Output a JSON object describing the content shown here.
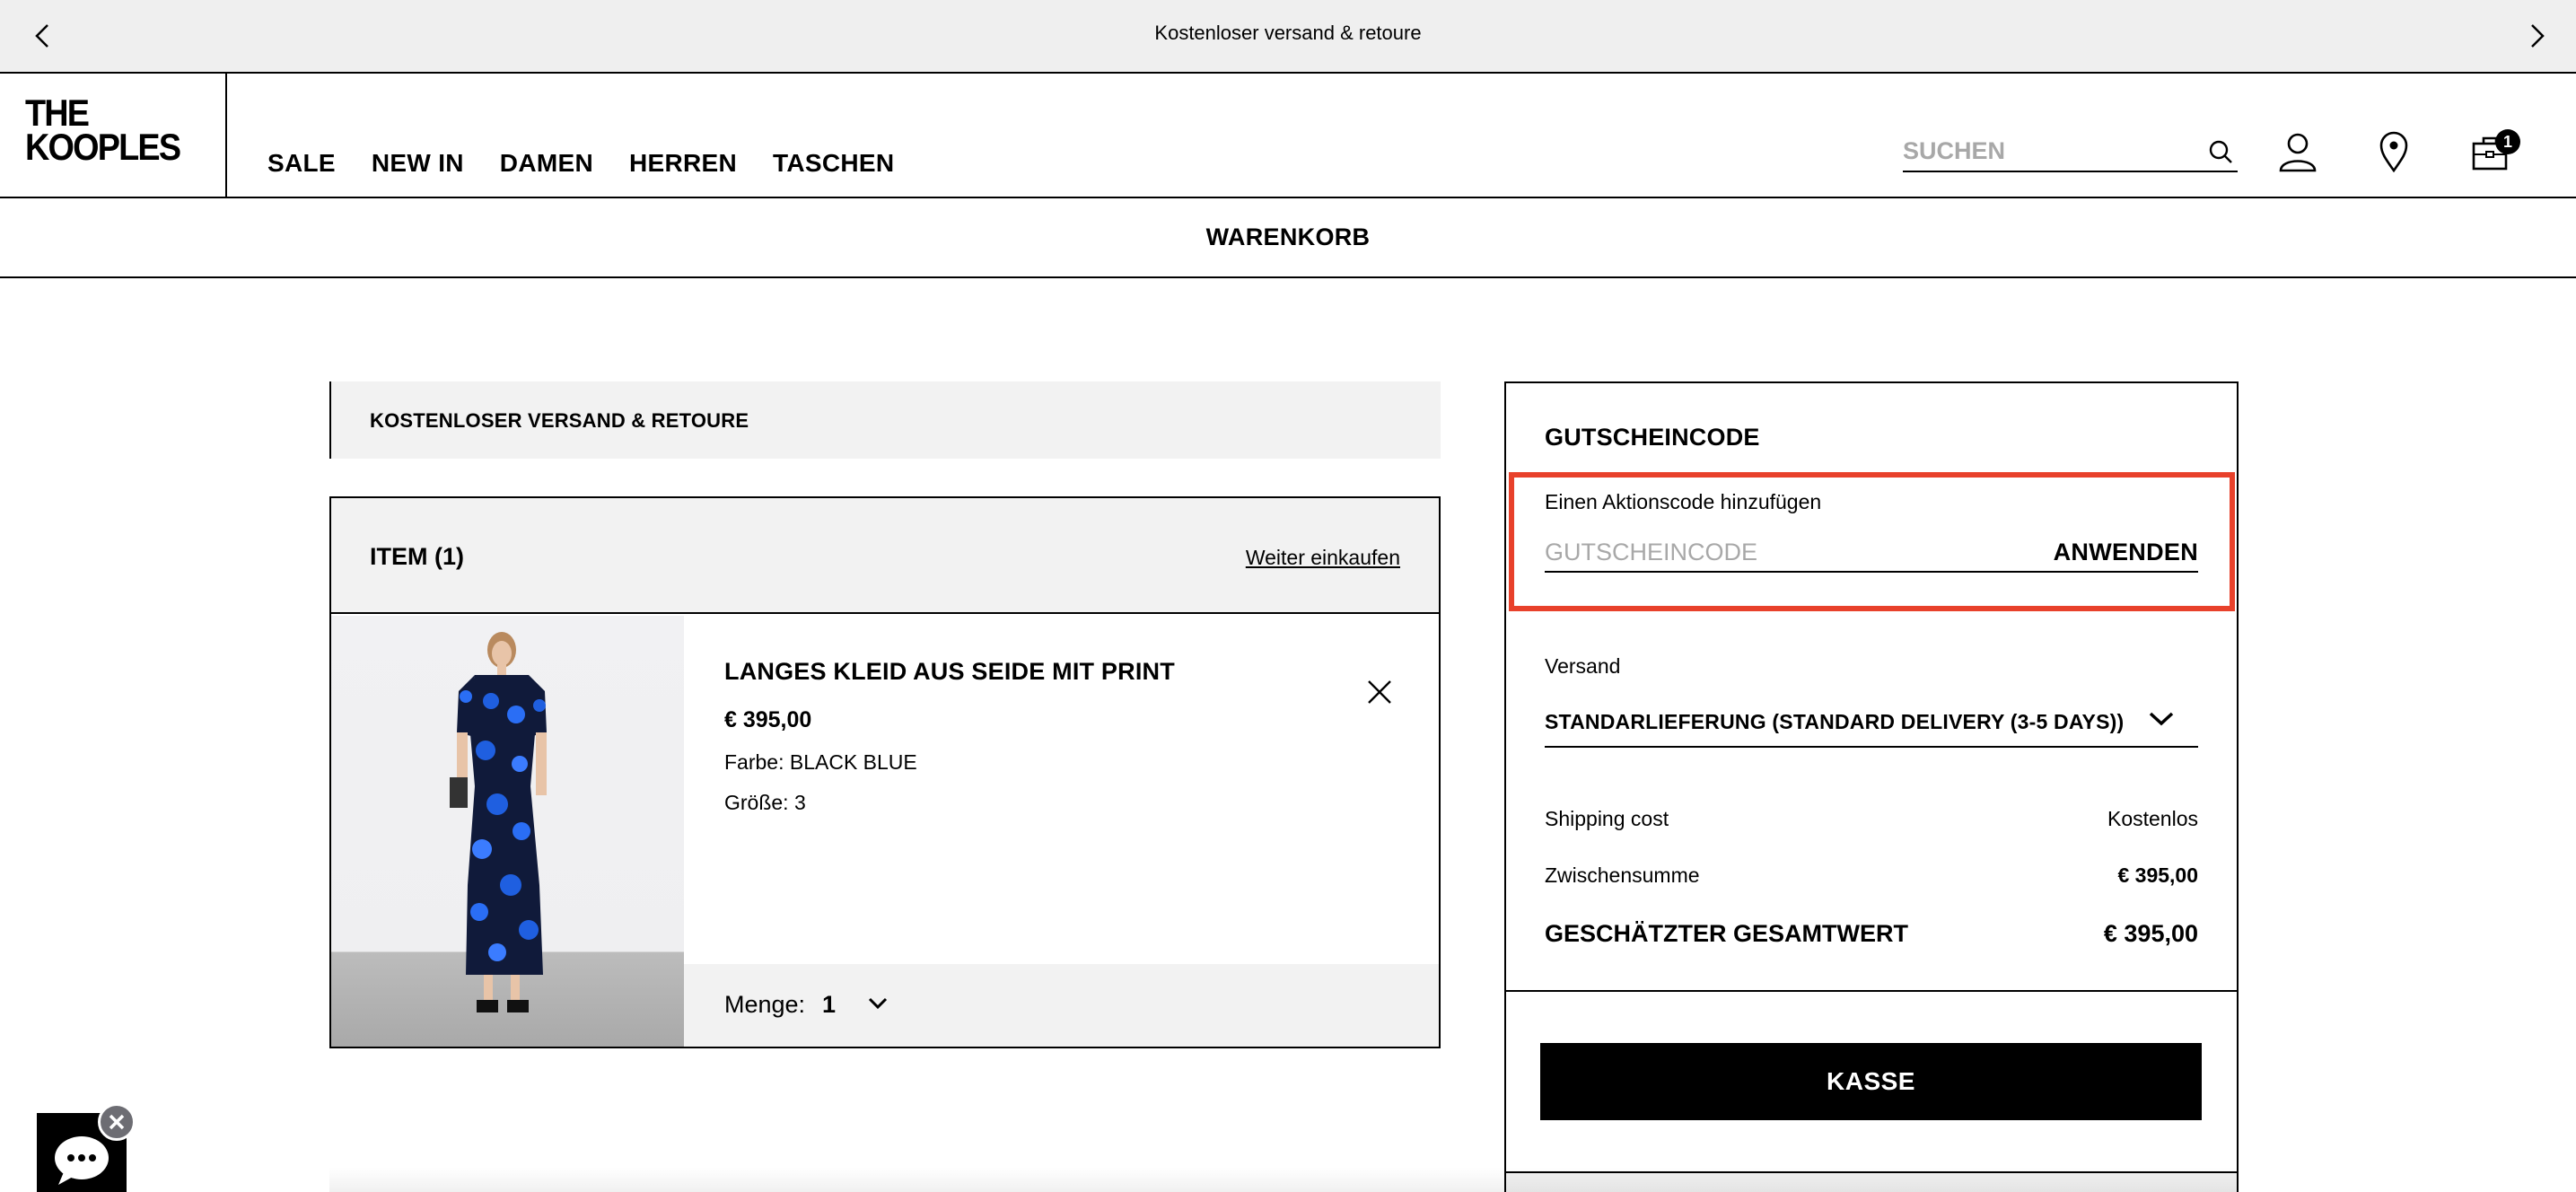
{
  "announcement": {
    "message": "Kostenloser versand & retoure",
    "prev_icon": "chevron-left-icon",
    "next_icon": "chevron-right-icon"
  },
  "header": {
    "logo_line1": "THE",
    "logo_line2": "KOOPLES",
    "nav": [
      "SALE",
      "NEW IN",
      "DAMEN",
      "HERREN",
      "TASCHEN"
    ],
    "search_placeholder": "SUCHEN",
    "icons": [
      "search-icon",
      "account-icon",
      "store-locator-icon",
      "cart-icon"
    ],
    "cart_count": "1"
  },
  "page_title": "WARENKORB",
  "shipping_banner": "KOSTENLOSER VERSAND & RETOURE",
  "cart": {
    "items_label": "ITEM (1)",
    "continue_shopping": "Weiter einkaufen",
    "item": {
      "name": "LANGES KLEID AUS SEIDE MIT PRINT",
      "price": "€ 395,00",
      "color": "Farbe: BLACK BLUE",
      "size": "Größe: 3",
      "quantity_label": "Menge:",
      "quantity": "1"
    }
  },
  "summary": {
    "coupon_title": "GUTSCHEINCODE",
    "promo_label": "Einen Aktionscode hinzufügen",
    "promo_placeholder": "GUTSCHEINCODE",
    "apply_label": "ANWENDEN",
    "shipping_label": "Versand",
    "shipping_option": "STANDARLIEFERUNG (STANDARD DELIVERY (3-5 DAYS))",
    "shipping_cost_label": "Shipping cost",
    "shipping_cost_value": "Kostenlos",
    "subtotal_label": "Zwischensumme",
    "subtotal_value": "€ 395,00",
    "total_label": "GESCHÄTZTER GESAMTWERT",
    "total_value": "€ 395,00",
    "checkout_label": "KASSE"
  },
  "colors": {
    "highlight": "#e8412b",
    "panel_bg": "#f2f2f2",
    "dress_blue": "#1f5fe0"
  }
}
